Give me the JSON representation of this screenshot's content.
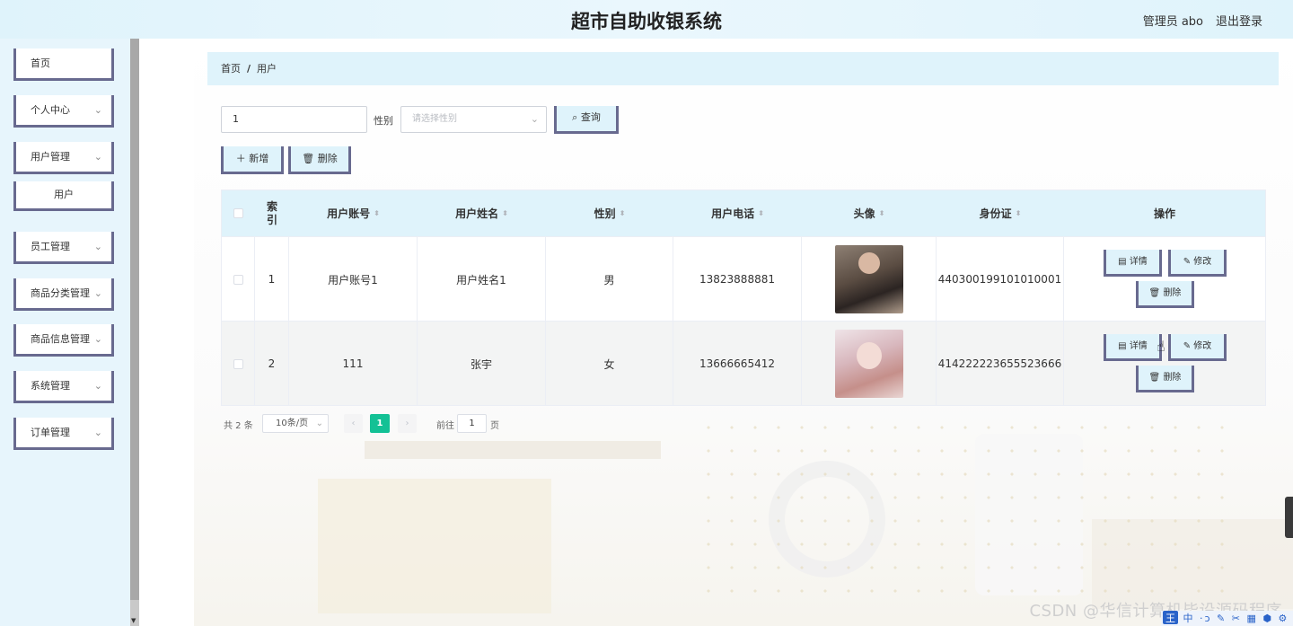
{
  "header": {
    "title": "超市自助收银系统",
    "user": "管理员 abo",
    "logout": "退出登录"
  },
  "sidebar": {
    "items": [
      {
        "label": "首页",
        "has_chevron": false
      },
      {
        "label": "个人中心",
        "has_chevron": true
      },
      {
        "label": "用户管理",
        "has_chevron": true,
        "expanded": true,
        "children": [
          "用户"
        ]
      },
      {
        "label": "员工管理",
        "has_chevron": true
      },
      {
        "label": "商品分类管理",
        "has_chevron": true
      },
      {
        "label": "商品信息管理",
        "has_chevron": true
      },
      {
        "label": "系统管理",
        "has_chevron": true
      },
      {
        "label": "订单管理",
        "has_chevron": true
      }
    ]
  },
  "breadcrumb": {
    "home": "首页",
    "separator": "/",
    "current": "用户"
  },
  "search": {
    "keyword_value": "1",
    "gender_label": "性别",
    "gender_placeholder": "请选择性别",
    "query_label": "查询"
  },
  "toolbar": {
    "add_label": "新增",
    "delete_label": "删除"
  },
  "table": {
    "columns": [
      {
        "label": "索\n引",
        "sortable": false
      },
      {
        "label": "用户账号",
        "sortable": true
      },
      {
        "label": "用户姓名",
        "sortable": true
      },
      {
        "label": "性别",
        "sortable": true
      },
      {
        "label": "用户电话",
        "sortable": true
      },
      {
        "label": "头像",
        "sortable": true
      },
      {
        "label": "身份证",
        "sortable": true
      },
      {
        "label": "操作",
        "sortable": false
      }
    ],
    "rows": [
      {
        "index": "1",
        "account": "用户账号1",
        "name": "用户姓名1",
        "gender": "男",
        "phone": "13823888881",
        "id_card": "440300199101010001"
      },
      {
        "index": "2",
        "account": "111",
        "name": "张宇",
        "gender": "女",
        "phone": "13666665412",
        "id_card": "414222223655523666"
      }
    ],
    "row_actions": {
      "detail": "详情",
      "edit": "修改",
      "delete": "删除"
    }
  },
  "pagination": {
    "total_text": "共 2 条",
    "page_size": "10条/页",
    "current_page": "1",
    "goto_prefix": "前往",
    "goto_value": "1",
    "goto_suffix": "页"
  },
  "watermark": "CSDN @华信计算机毕设源码程序",
  "colors": {
    "accent": "#13c195",
    "header_bg": "#dff3fb",
    "button_border": "#686a8f"
  }
}
